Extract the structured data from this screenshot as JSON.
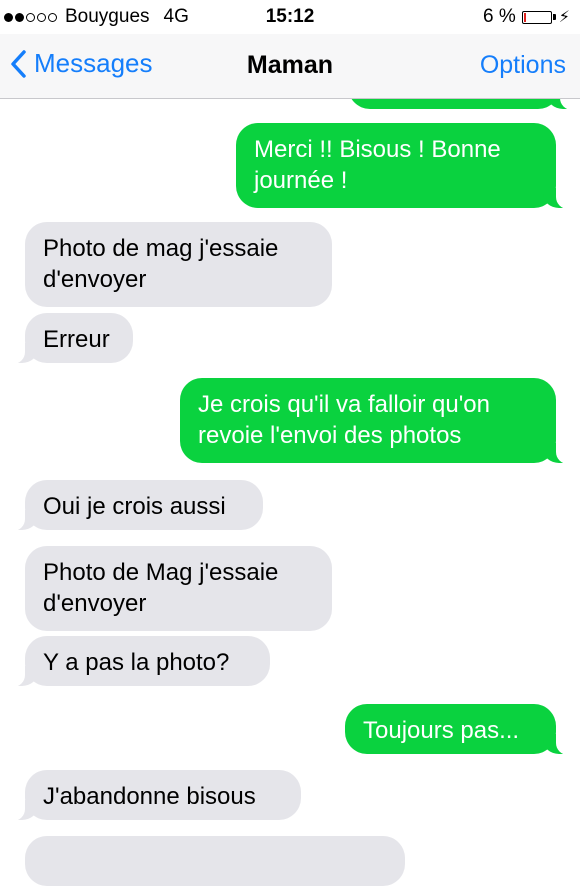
{
  "status_bar": {
    "signal_filled": 2,
    "signal_total": 5,
    "carrier": "Bouygues",
    "network": "4G",
    "time": "15:12",
    "battery_text": "6 %",
    "battery_level": 0.06,
    "battery_color": "#e0231f",
    "charging_icon": "lightning-bolt-icon"
  },
  "nav": {
    "back_label": "Messages",
    "back_icon": "chevron-left-icon",
    "title": "Maman",
    "options_label": "Options"
  },
  "colors": {
    "sent_bubble": "#0ad23f",
    "received_bubble": "#e5e5ea",
    "accent": "#157efb"
  },
  "messages": [
    {
      "direction": "sent",
      "text": ""
    },
    {
      "direction": "sent",
      "text": "Merci !! Bisous ! Bonne journée !"
    },
    {
      "direction": "received",
      "text": "Photo de mag j'essaie d'envoyer"
    },
    {
      "direction": "received",
      "text": "Erreur"
    },
    {
      "direction": "sent",
      "text": "Je crois qu'il va falloir qu'on revoie l'envoi des photos"
    },
    {
      "direction": "received",
      "text": "Oui je crois aussi"
    },
    {
      "direction": "received",
      "text": "Photo de Mag j'essaie d'envoyer"
    },
    {
      "direction": "received",
      "text": "Y a pas la photo?"
    },
    {
      "direction": "sent",
      "text": "Toujours pas..."
    },
    {
      "direction": "received",
      "text": "J'abandonne bisous"
    },
    {
      "direction": "received",
      "text": ""
    }
  ]
}
